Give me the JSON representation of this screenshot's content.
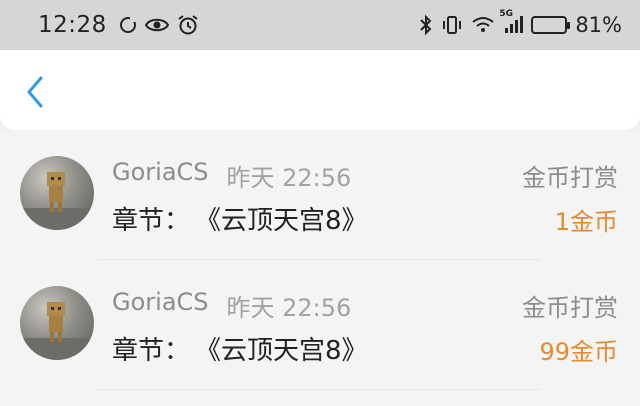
{
  "status_bar": {
    "time": "12:28",
    "battery": "81%",
    "battery_level": 0.81,
    "signal_label": "5G"
  },
  "navbar": {
    "back_icon": "chevron-left-icon",
    "accent_color": "#2b9df0"
  },
  "records": [
    {
      "user": "GoriaCS",
      "time": "昨天 22:56",
      "chapter_label": "章节：",
      "chapter_title": "《云顶天宫8》",
      "type": "金币打赏",
      "amount": "1金币"
    },
    {
      "user": "GoriaCS",
      "time": "昨天 22:56",
      "chapter_label": "章节：",
      "chapter_title": "《云顶天宫8》",
      "type": "金币打赏",
      "amount": "99金币"
    }
  ],
  "colors": {
    "amount": "#e68a2e",
    "muted_text": "#9a9a9a",
    "status_bar_bg": "#d6d6d6"
  }
}
